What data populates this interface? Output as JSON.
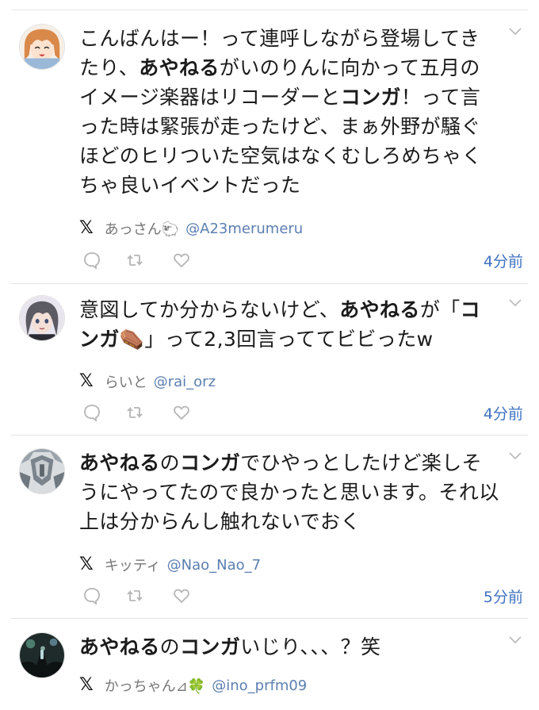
{
  "posts": [
    {
      "segments": [
        {
          "t": "こんばんはー！って連呼しながら登場してきたり、",
          "b": false
        },
        {
          "t": "あやねる",
          "b": true
        },
        {
          "t": "がいのりんに向かって五月のイメージ楽器はリコーダーと",
          "b": false
        },
        {
          "t": "コンガ",
          "b": true
        },
        {
          "t": "！って言った時は緊張が走ったけど、まぁ外野が騒ぐほどのヒリついた空気はなくむしろめちゃくちゃ良いイベントだった",
          "b": false
        }
      ],
      "username": "あっさん🐑",
      "handle": "@A23merumeru",
      "time": "4分前"
    },
    {
      "segments": [
        {
          "t": "意図してか分からないけど、",
          "b": false
        },
        {
          "t": "あやねる",
          "b": true
        },
        {
          "t": "が「",
          "b": false
        },
        {
          "t": "コンガ",
          "b": true
        },
        {
          "t": "⚰️」って2,3回言っててビビったw",
          "b": false
        }
      ],
      "username": "らいと",
      "handle": "@rai_orz",
      "time": "4分前"
    },
    {
      "segments": [
        {
          "t": "あやねる",
          "b": true
        },
        {
          "t": "の",
          "b": false
        },
        {
          "t": "コンガ",
          "b": true
        },
        {
          "t": "でひやっとしたけど楽しそうにやってたので良かったと思います。それ以上は分からんし触れないでおく",
          "b": false
        }
      ],
      "username": "キッティ",
      "handle": "@Nao_Nao_7",
      "time": "5分前"
    },
    {
      "segments": [
        {
          "t": "あやねる",
          "b": true
        },
        {
          "t": "の",
          "b": false
        },
        {
          "t": "コンガ",
          "b": true
        },
        {
          "t": "いじり、、、？笑",
          "b": false
        }
      ],
      "username": "かっちゃん⊿🍀",
      "handle": "@ino_prfm09",
      "time": ""
    }
  ],
  "x_logo": "𝕏",
  "icons": {
    "reply": "reply-icon",
    "repost": "repost-icon",
    "like": "like-icon",
    "more": "chevron-down-icon"
  },
  "colors": {
    "handle": "#5b7fb0",
    "time": "#3f72c2",
    "icon": "#b5b5b5",
    "text": "#1b1b1b"
  }
}
